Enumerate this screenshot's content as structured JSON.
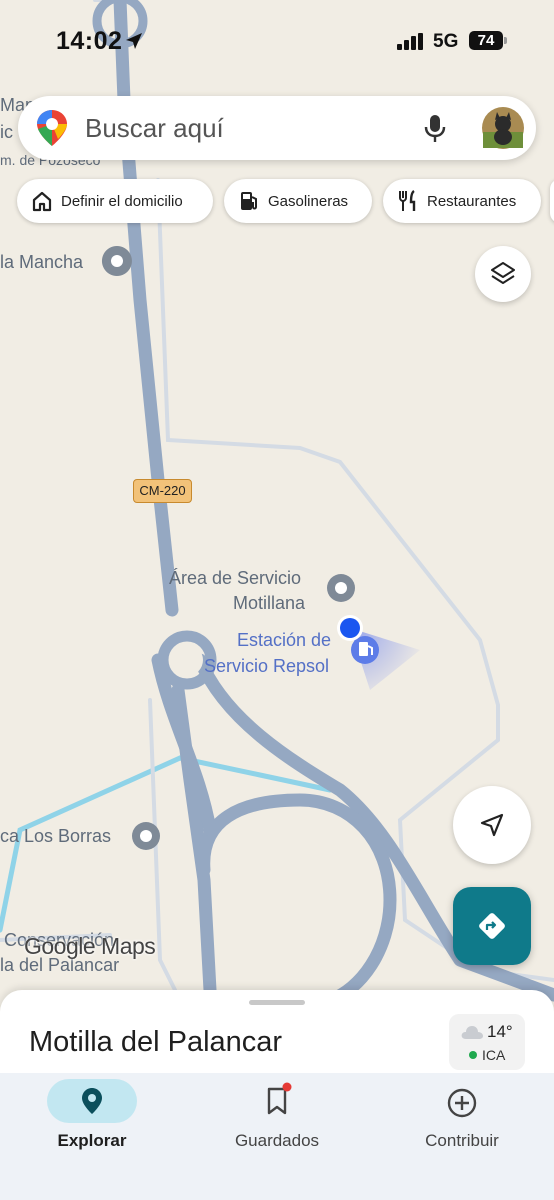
{
  "status_bar": {
    "time": "14:02",
    "network": "5G",
    "battery": "74"
  },
  "search": {
    "placeholder": "Buscar aquí"
  },
  "chips": [
    {
      "label": "Definir el domicilio",
      "icon": "home-icon"
    },
    {
      "label": "Gasolineras",
      "icon": "gas-station-icon"
    },
    {
      "label": "Restaurantes",
      "icon": "restaurant-icon"
    }
  ],
  "map": {
    "road_shield": "CM-220",
    "labels": {
      "top_left_1": "Man",
      "top_left_2": "ic",
      "top_left_3": "m. de Pozoseco",
      "mancha": "la Mancha",
      "area_servicio_1": "Área de Servicio",
      "area_servicio_2": "Motillana",
      "estacion_1": "Estación de",
      "estacion_2": "Servicio Repsol",
      "borras": "ca Los Borras",
      "conservacion_1": "Conservación",
      "conservacion_2": "la del Palancar"
    },
    "logo": "Google Maps"
  },
  "sheet": {
    "title": "Motilla del Palancar",
    "weather": {
      "temp": "14°",
      "air_quality": "ICA"
    }
  },
  "nav": [
    {
      "label": "Explorar",
      "icon": "explore-pin-icon",
      "active": true
    },
    {
      "label": "Guardados",
      "icon": "bookmark-icon",
      "active": false
    },
    {
      "label": "Contribuir",
      "icon": "add-circle-icon",
      "active": false
    }
  ],
  "colors": {
    "accent": "#0f7a8a",
    "location_dot": "#1a56f0",
    "roads": "#95a8c2",
    "water": "#8fd3e8"
  }
}
